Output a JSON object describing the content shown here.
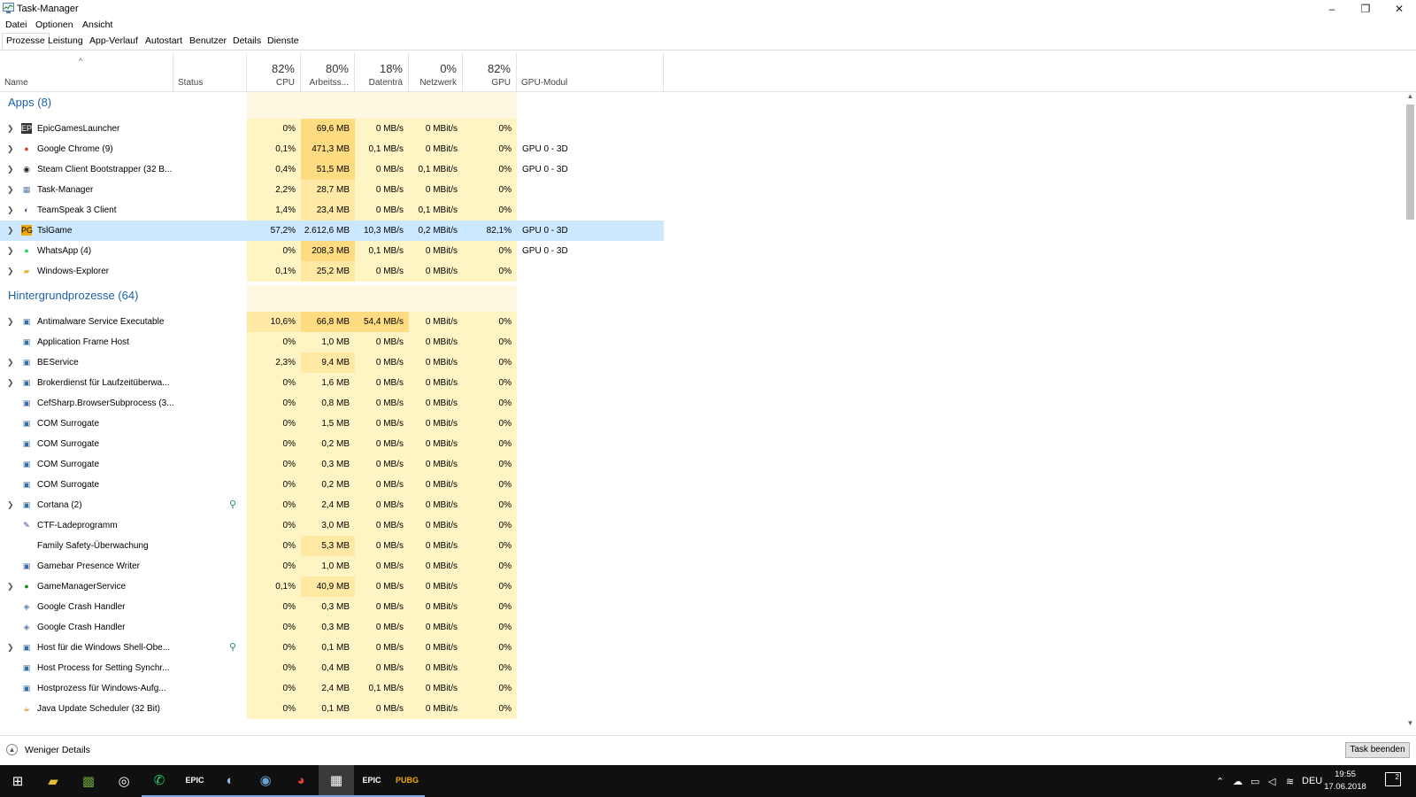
{
  "window": {
    "title": "Task-Manager",
    "controls": {
      "minimize": "–",
      "restore": "❐",
      "close": "✕"
    }
  },
  "menu": [
    "Datei",
    "Optionen",
    "Ansicht"
  ],
  "tabs": [
    {
      "label": "Prozesse",
      "active": true
    },
    {
      "label": "Leistung"
    },
    {
      "label": "App-Verlauf"
    },
    {
      "label": "Autostart"
    },
    {
      "label": "Benutzer"
    },
    {
      "label": "Details"
    },
    {
      "label": "Dienste"
    }
  ],
  "columns": {
    "name": "Name",
    "status": "Status",
    "cpu": {
      "pct": "82%",
      "label": "CPU"
    },
    "mem": {
      "pct": "80%",
      "label": "Arbeitss..."
    },
    "disk": {
      "pct": "18%",
      "label": "Datenträ"
    },
    "net": {
      "pct": "0%",
      "label": "Netzwerk"
    },
    "gpu": {
      "pct": "82%",
      "label": "GPU"
    },
    "gpu_engine": "GPU-Modul",
    "sort_indicator": "^"
  },
  "colors": {
    "heat_low": "#fff4c4",
    "heat_mid": "#ffe9a5",
    "heat_high": "#ffdb82",
    "heat_header": "#fff8e1",
    "selected": "#cce8ff",
    "accent": "#1e5fa6"
  },
  "groups": [
    {
      "title": "Apps (8)",
      "rows": [
        {
          "expand": true,
          "icon": "epic-games-icon",
          "name": "EpicGamesLauncher",
          "cpu": "0%",
          "mem": "69,6 MB",
          "disk": "0 MB/s",
          "net": "0 MBit/s",
          "gpu": "0%",
          "gpu_engine": ""
        },
        {
          "expand": true,
          "icon": "chrome-icon",
          "name": "Google Chrome (9)",
          "cpu": "0,1%",
          "mem": "471,3 MB",
          "disk": "0,1 MB/s",
          "net": "0 MBit/s",
          "gpu": "0%",
          "gpu_engine": "GPU 0 - 3D"
        },
        {
          "expand": true,
          "icon": "steam-icon",
          "name": "Steam Client Bootstrapper (32 B...",
          "cpu": "0,4%",
          "mem": "51,5 MB",
          "disk": "0 MB/s",
          "net": "0,1 MBit/s",
          "gpu": "0%",
          "gpu_engine": "GPU 0 - 3D"
        },
        {
          "expand": true,
          "icon": "task-manager-icon",
          "name": "Task-Manager",
          "cpu": "2,2%",
          "mem": "28,7 MB",
          "disk": "0 MB/s",
          "net": "0 MBit/s",
          "gpu": "0%",
          "gpu_engine": ""
        },
        {
          "expand": true,
          "icon": "teamspeak-icon",
          "name": "TeamSpeak 3 Client",
          "cpu": "1,4%",
          "mem": "23,4 MB",
          "disk": "0 MB/s",
          "net": "0,1 MBit/s",
          "gpu": "0%",
          "gpu_engine": ""
        },
        {
          "expand": true,
          "icon": "tslgame-icon",
          "name": "TslGame",
          "cpu": "57,2%",
          "mem": "2.612,6 MB",
          "disk": "10,3 MB/s",
          "net": "0,2 MBit/s",
          "gpu": "82,1%",
          "gpu_engine": "GPU 0 - 3D",
          "selected": true
        },
        {
          "expand": true,
          "icon": "whatsapp-icon",
          "name": "WhatsApp (4)",
          "cpu": "0%",
          "mem": "208,3 MB",
          "disk": "0,1 MB/s",
          "net": "0 MBit/s",
          "gpu": "0%",
          "gpu_engine": "GPU 0 - 3D"
        },
        {
          "expand": true,
          "icon": "explorer-icon",
          "name": "Windows-Explorer",
          "cpu": "0,1%",
          "mem": "25,2 MB",
          "disk": "0 MB/s",
          "net": "0 MBit/s",
          "gpu": "0%",
          "gpu_engine": ""
        }
      ]
    },
    {
      "title": "Hintergrundprozesse (64)",
      "rows": [
        {
          "expand": true,
          "icon": "process-icon",
          "name": "Antimalware Service Executable",
          "cpu": "10,6%",
          "mem": "66,8 MB",
          "disk": "54,4 MB/s",
          "net": "0 MBit/s",
          "gpu": "0%"
        },
        {
          "expand": false,
          "icon": "process-icon",
          "name": "Application Frame Host",
          "cpu": "0%",
          "mem": "1,0 MB",
          "disk": "0 MB/s",
          "net": "0 MBit/s",
          "gpu": "0%"
        },
        {
          "expand": true,
          "icon": "process-icon",
          "name": "BEService",
          "cpu": "2,3%",
          "mem": "9,4 MB",
          "disk": "0 MB/s",
          "net": "0 MBit/s",
          "gpu": "0%"
        },
        {
          "expand": true,
          "icon": "process-icon",
          "name": "Brokerdienst für Laufzeitüberwa...",
          "cpu": "0%",
          "mem": "1,6 MB",
          "disk": "0 MB/s",
          "net": "0 MBit/s",
          "gpu": "0%"
        },
        {
          "expand": false,
          "icon": "process-icon",
          "name": "CefSharp.BrowserSubprocess (3...",
          "cpu": "0%",
          "mem": "0,8 MB",
          "disk": "0 MB/s",
          "net": "0 MBit/s",
          "gpu": "0%"
        },
        {
          "expand": false,
          "icon": "process-icon",
          "name": "COM Surrogate",
          "cpu": "0%",
          "mem": "1,5 MB",
          "disk": "0 MB/s",
          "net": "0 MBit/s",
          "gpu": "0%"
        },
        {
          "expand": false,
          "icon": "process-icon",
          "name": "COM Surrogate",
          "cpu": "0%",
          "mem": "0,2 MB",
          "disk": "0 MB/s",
          "net": "0 MBit/s",
          "gpu": "0%"
        },
        {
          "expand": false,
          "icon": "process-icon",
          "name": "COM Surrogate",
          "cpu": "0%",
          "mem": "0,3 MB",
          "disk": "0 MB/s",
          "net": "0 MBit/s",
          "gpu": "0%"
        },
        {
          "expand": false,
          "icon": "process-icon",
          "name": "COM Surrogate",
          "cpu": "0%",
          "mem": "0,2 MB",
          "disk": "0 MB/s",
          "net": "0 MBit/s",
          "gpu": "0%"
        },
        {
          "expand": true,
          "icon": "process-icon",
          "name": "Cortana (2)",
          "cpu": "0%",
          "mem": "2,4 MB",
          "disk": "0 MB/s",
          "net": "0 MBit/s",
          "gpu": "0%",
          "leaf": true
        },
        {
          "expand": false,
          "icon": "ctf-icon",
          "name": "CTF-Ladeprogramm",
          "cpu": "0%",
          "mem": "3,0 MB",
          "disk": "0 MB/s",
          "net": "0 MBit/s",
          "gpu": "0%"
        },
        {
          "expand": false,
          "icon": "",
          "name": "Family Safety-Überwachung",
          "cpu": "0%",
          "mem": "5,3 MB",
          "disk": "0 MB/s",
          "net": "0 MBit/s",
          "gpu": "0%"
        },
        {
          "expand": false,
          "icon": "process-icon",
          "name": "Gamebar Presence Writer",
          "cpu": "0%",
          "mem": "1,0 MB",
          "disk": "0 MB/s",
          "net": "0 MBit/s",
          "gpu": "0%"
        },
        {
          "expand": true,
          "icon": "razer-icon",
          "name": "GameManagerService",
          "cpu": "0,1%",
          "mem": "40,9 MB",
          "disk": "0 MB/s",
          "net": "0 MBit/s",
          "gpu": "0%"
        },
        {
          "expand": false,
          "icon": "crash-handler-icon",
          "name": "Google Crash Handler",
          "cpu": "0%",
          "mem": "0,3 MB",
          "disk": "0 MB/s",
          "net": "0 MBit/s",
          "gpu": "0%"
        },
        {
          "expand": false,
          "icon": "crash-handler-icon",
          "name": "Google Crash Handler",
          "cpu": "0%",
          "mem": "0,3 MB",
          "disk": "0 MB/s",
          "net": "0 MBit/s",
          "gpu": "0%"
        },
        {
          "expand": true,
          "icon": "process-icon",
          "name": "Host für die Windows Shell-Obe...",
          "cpu": "0%",
          "mem": "0,1 MB",
          "disk": "0 MB/s",
          "net": "0 MBit/s",
          "gpu": "0%",
          "leaf": true
        },
        {
          "expand": false,
          "icon": "process-icon",
          "name": "Host Process for Setting Synchr...",
          "cpu": "0%",
          "mem": "0,4 MB",
          "disk": "0 MB/s",
          "net": "0 MBit/s",
          "gpu": "0%"
        },
        {
          "expand": false,
          "icon": "process-icon",
          "name": "Hostprozess für Windows-Aufg...",
          "cpu": "0%",
          "mem": "2,4 MB",
          "disk": "0,1 MB/s",
          "net": "0 MBit/s",
          "gpu": "0%"
        },
        {
          "expand": false,
          "icon": "java-icon",
          "name": "Java Update Scheduler (32 Bit)",
          "cpu": "0%",
          "mem": "0,1 MB",
          "disk": "0 MB/s",
          "net": "0 MBit/s",
          "gpu": "0%"
        }
      ]
    }
  ],
  "footer": {
    "less_details": "Weniger Details",
    "end_task": "Task beenden"
  },
  "taskbar": {
    "apps": [
      {
        "icon": "windows-start-icon"
      },
      {
        "icon": "file-explorer-icon"
      },
      {
        "icon": "minecraft-icon"
      },
      {
        "icon": "origin-icon"
      },
      {
        "icon": "whatsapp-icon",
        "running": true
      },
      {
        "icon": "epic-games-icon",
        "running": true,
        "label": "EPIC"
      },
      {
        "icon": "teamspeak-icon",
        "running": true
      },
      {
        "icon": "steam-icon",
        "running": true
      },
      {
        "icon": "chrome-icon",
        "running": true
      },
      {
        "icon": "task-manager-icon",
        "running": true,
        "active": true
      },
      {
        "icon": "epic-games-icon",
        "running": true,
        "label": "EPIC"
      },
      {
        "icon": "pubg-icon",
        "running": true,
        "label": "PUBG"
      }
    ],
    "tray": {
      "language": "DEU",
      "time": "19:55",
      "date": "17.06.2018",
      "notifications": "2"
    }
  }
}
